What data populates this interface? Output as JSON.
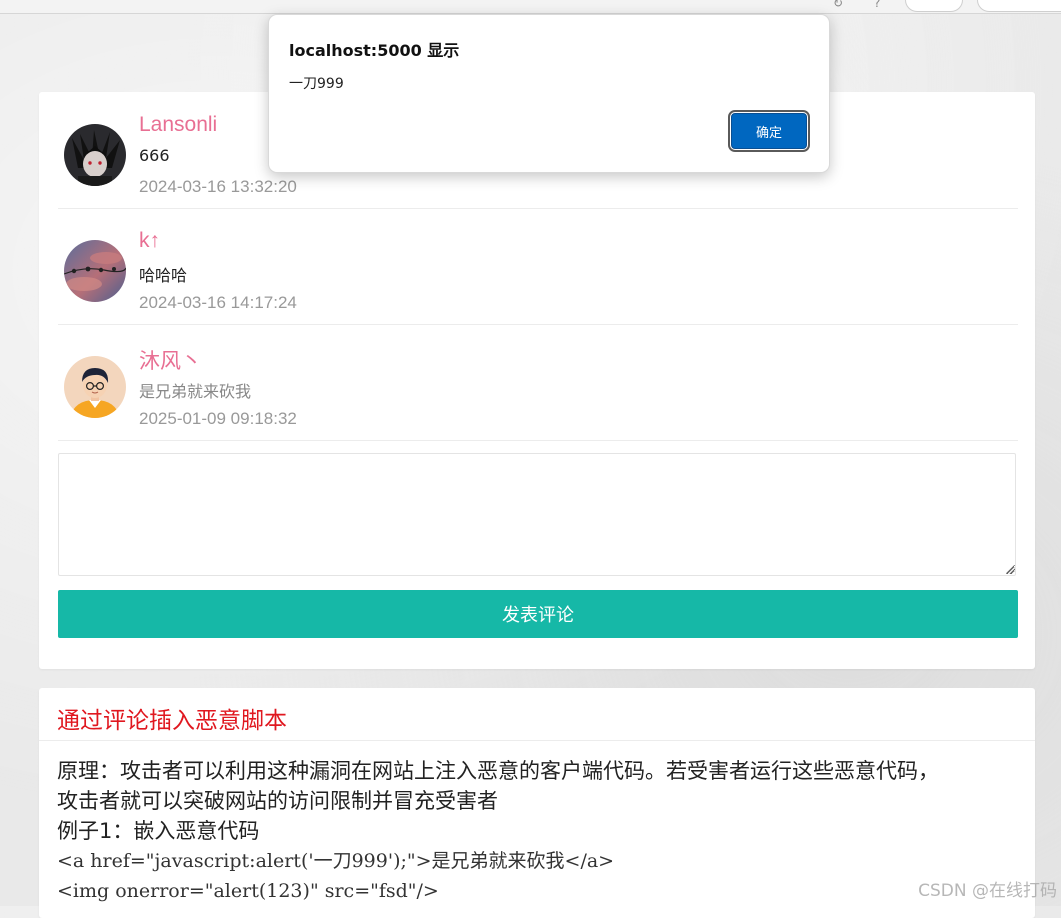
{
  "alert": {
    "title": "localhost:5000 显示",
    "message": "一刀999",
    "ok_label": "确定"
  },
  "comments": [
    {
      "name": "Lansonli",
      "text": "666",
      "time": "2024-03-16 13:32:20"
    },
    {
      "name": "k↑",
      "text": "哈哈哈",
      "time": "2024-03-16 14:17:24"
    },
    {
      "name": "沐风丶",
      "text": "是兄弟就来砍我",
      "time": "2025-01-09 09:18:32"
    }
  ],
  "comment_form": {
    "placeholder": "",
    "submit_label": "发表评论"
  },
  "article": {
    "title": "通过评论插入恶意脚本",
    "paragraph_line1": "原理：攻击者可以利用这种漏洞在网站上注入恶意的客户端代码。若受害者运行这些恶意代码，",
    "paragraph_line2": "攻击者就可以突破网站的访问限制并冒充受害者",
    "example_label": "例子1：嵌入恶意代码",
    "code_line1": "<a href=\"javascript:alert('一刀999');\">是兄弟就来砍我</a>",
    "code_line2": "<img onerror=\"alert(123)\" src=\"fsd\"/>"
  },
  "watermark": "CSDN @在线打码",
  "colors": {
    "name": "#e86f93",
    "submit": "#16b8a7",
    "article_title": "#e0171f",
    "dialog_button": "#0067c0"
  }
}
